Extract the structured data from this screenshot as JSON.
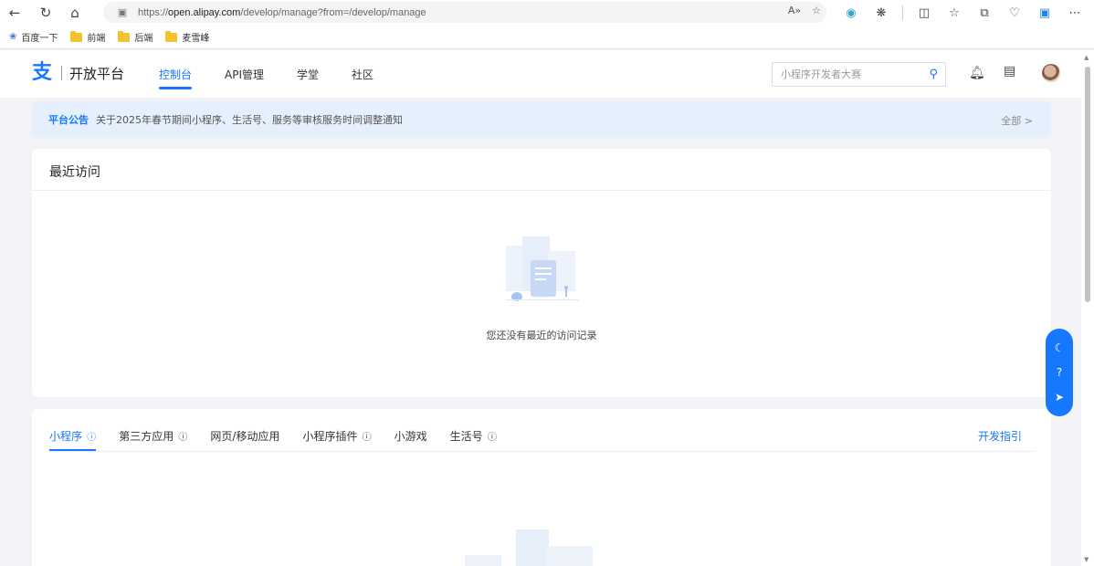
{
  "browser": {
    "url_prefix": "https://",
    "url_host": "open.alipay.com",
    "url_path": "/develop/manage?from=/develop/manage",
    "read_aloud": "A»",
    "icons": [
      "back-icon",
      "refresh-icon",
      "home-icon",
      "lock-icon",
      "favorite-icon",
      "extension-icon",
      "split-icon",
      "favorites-list-icon",
      "collections-icon",
      "performance-icon",
      "edge-icon",
      "more-icon"
    ]
  },
  "bookmarks": [
    {
      "label": "百度一下",
      "icon": "paw-icon"
    },
    {
      "label": "前端",
      "icon": "folder-icon"
    },
    {
      "label": "后端",
      "icon": "folder-icon"
    },
    {
      "label": "麦雪峰",
      "icon": "folder-icon"
    }
  ],
  "header": {
    "logo_mark": "支",
    "logo_text": "开放平台",
    "nav": [
      {
        "label": "控制台",
        "active": true
      },
      {
        "label": "API管理",
        "active": false
      },
      {
        "label": "学堂",
        "active": false
      },
      {
        "label": "社区",
        "active": false
      }
    ],
    "search_placeholder": "小程序开发者大赛"
  },
  "notice": {
    "tag": "平台公告",
    "text": "关于2025年春节期间小程序、生活号、服务等审核服务时间调整通知",
    "all": "全部 >"
  },
  "recent": {
    "title": "最近访问",
    "empty_text": "您还没有最近的访问记录"
  },
  "apps": {
    "tabs": [
      {
        "label": "小程序",
        "info": true,
        "active": true
      },
      {
        "label": "第三方应用",
        "info": true,
        "active": false
      },
      {
        "label": "网页/移动应用",
        "info": false,
        "active": false
      },
      {
        "label": "小程序插件",
        "info": true,
        "active": false
      },
      {
        "label": "小游戏",
        "info": false,
        "active": false
      },
      {
        "label": "生活号",
        "info": true,
        "active": false
      }
    ],
    "guide": "开发指引"
  },
  "colors": {
    "brand": "#1677ff",
    "notice_bg": "#e6f0fc",
    "page_bg": "#f1f3f6"
  }
}
